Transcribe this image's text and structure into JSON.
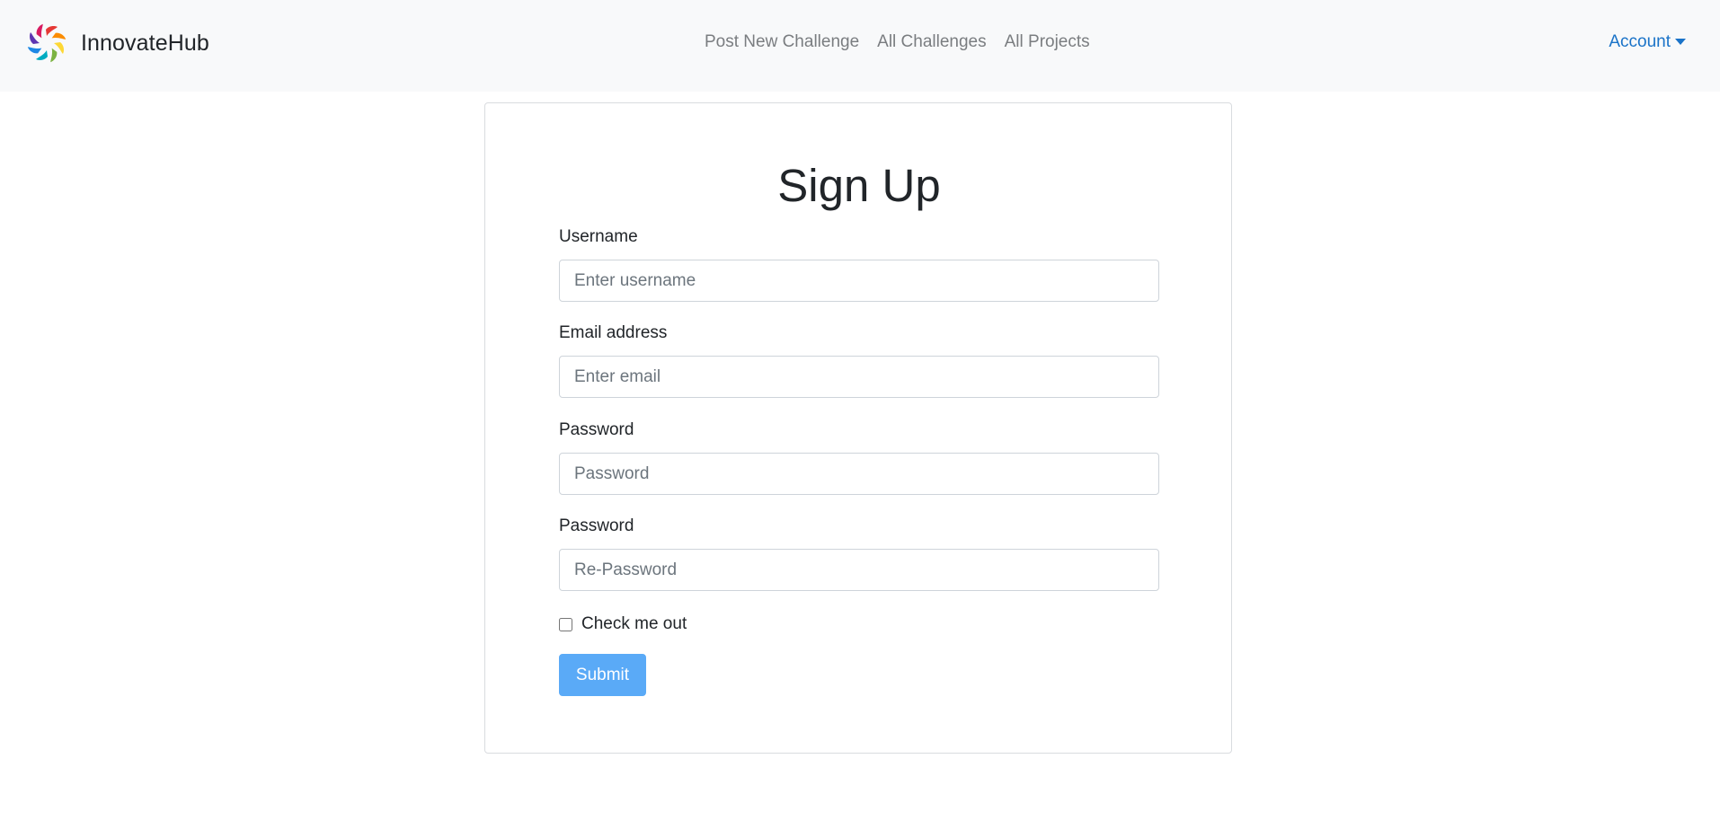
{
  "navbar": {
    "brand_name": "InnovateHub",
    "links": [
      {
        "label": "Post New Challenge"
      },
      {
        "label": "All Challenges"
      },
      {
        "label": "All Projects"
      }
    ],
    "account_label": "Account",
    "account_color": "#1a73c8"
  },
  "form": {
    "title": "Sign Up",
    "username": {
      "label": "Username",
      "placeholder": "Enter username",
      "value": ""
    },
    "email": {
      "label": "Email address",
      "placeholder": "Enter email",
      "value": ""
    },
    "password": {
      "label": "Password",
      "placeholder": "Password",
      "value": ""
    },
    "repassword": {
      "label": "Password",
      "placeholder": "Re-Password",
      "value": ""
    },
    "checkbox": {
      "label": "Check me out",
      "checked": false
    },
    "submit_label": "Submit",
    "submit_color": "#5aaaf7"
  },
  "icons": {
    "brand_logo": "pinwheel-logo-icon",
    "account_caret": "caret-down-icon"
  }
}
